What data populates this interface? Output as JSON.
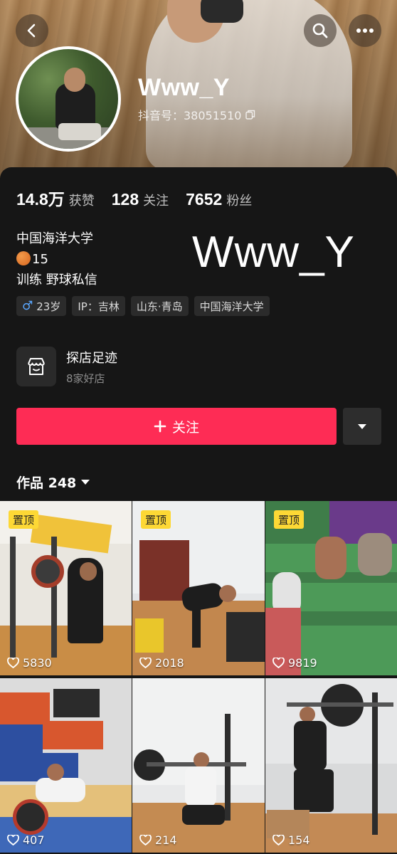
{
  "header": {
    "back_icon": "chevron-left-icon",
    "search_icon": "search-icon",
    "more_icon": "more-horizontal-icon"
  },
  "profile": {
    "nickname": "Www_Y",
    "douyin_id": "抖音号：38051510",
    "stats": [
      {
        "value": "14.8万",
        "label": "获赞"
      },
      {
        "value": "128",
        "label": "关注"
      },
      {
        "value": "7652",
        "label": "粉丝"
      }
    ],
    "bio_lines": [
      "中国海洋大学",
      "15",
      "训练 野球私信"
    ],
    "watermark": "Www_Y",
    "tags": [
      {
        "text": "23岁",
        "icon": "male-icon"
      },
      {
        "text": "IP：吉林"
      },
      {
        "text": "山东·青岛"
      },
      {
        "text": "中国海洋大学"
      }
    ]
  },
  "store": {
    "title": "探店足迹",
    "subtitle": "8家好店"
  },
  "actions": {
    "follow_label": "关注",
    "follow_color": "#fe2c55"
  },
  "works": {
    "label": "作品 248",
    "pin_label": "置顶",
    "videos": [
      {
        "likes": "5830",
        "pinned": true
      },
      {
        "likes": "2018",
        "pinned": true
      },
      {
        "likes": "9819",
        "pinned": true
      },
      {
        "likes": "407",
        "pinned": false
      },
      {
        "likes": "214",
        "pinned": false
      },
      {
        "likes": "154",
        "pinned": false
      }
    ]
  }
}
